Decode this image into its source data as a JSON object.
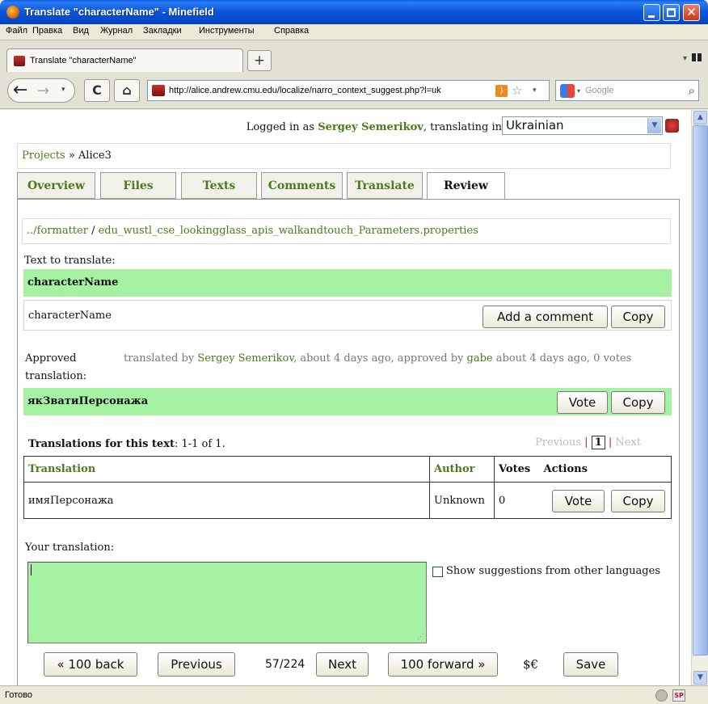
{
  "window": {
    "title": "Translate \"characterName\" - Minefield"
  },
  "menu": [
    "Файл",
    "Правка",
    "Вид",
    "Журнал",
    "Закладки",
    "Инструменты",
    "Справка"
  ],
  "browser_tab": {
    "label": "Translate \"characterName\""
  },
  "nav": {
    "url": "http://alice.andrew.cmu.edu/localize/narro_context_suggest.php?l=uk",
    "search_placeholder": "Google"
  },
  "status": {
    "text": "Готово"
  },
  "login": {
    "prefix": "Logged in as ",
    "user": "Sergey Semerikov",
    "suffix": ", translating in",
    "language": "Ukrainian"
  },
  "breadcrumb": {
    "projects": "Projects",
    "sep": " » ",
    "current": "Alice3"
  },
  "tabs": [
    "Overview",
    "Files",
    "Texts",
    "Comments",
    "Translate",
    "Review"
  ],
  "path": {
    "prefix": "../",
    "folder": "formatter",
    "sep": " / ",
    "file": "edu_wustl_cse_lookingglass_apis_walkandtouch_Parameters.properties"
  },
  "text_to_translate": {
    "label": "Text to translate:",
    "key": "characterName",
    "value": "characterName",
    "add_comment": "Add a comment",
    "copy": "Copy"
  },
  "approved": {
    "label_line1": "Approved",
    "label_line2": "translation:",
    "by_prefix": "translated by ",
    "translator": "Sergey Semerikov",
    "mid": ", about 4 days ago, approved by ",
    "approver": "gabe",
    "suffix": " about 4 days ago, 0 votes",
    "text": "якЗватиПерсонажа",
    "vote": "Vote",
    "copy": "Copy"
  },
  "translations": {
    "heading": "Translations for this text",
    "count": ": 1-1 of 1.",
    "pager": {
      "previous": "Previous",
      "sep": "|",
      "page": "1",
      "next": "Next"
    },
    "columns": {
      "translation": "Translation",
      "author": "Author",
      "votes": "Votes",
      "actions": "Actions"
    },
    "rows": [
      {
        "translation": "имяПерсонажа",
        "author": "Unknown",
        "votes": "0",
        "vote": "Vote",
        "copy": "Copy"
      }
    ]
  },
  "your_translation": {
    "label": "Your translation:",
    "value": "",
    "suggest_label": "Show suggestions from other languages"
  },
  "footer": {
    "back100": "« 100 back",
    "previous": "Previous",
    "position": "57/224",
    "next": "Next",
    "forward100": "100 forward »",
    "currency": "$€",
    "save": "Save"
  },
  "colors": {
    "accent_link": "#4a7a1e",
    "highlight_green": "#a5f2a2",
    "titlebar_blue": "#0a55d8"
  }
}
